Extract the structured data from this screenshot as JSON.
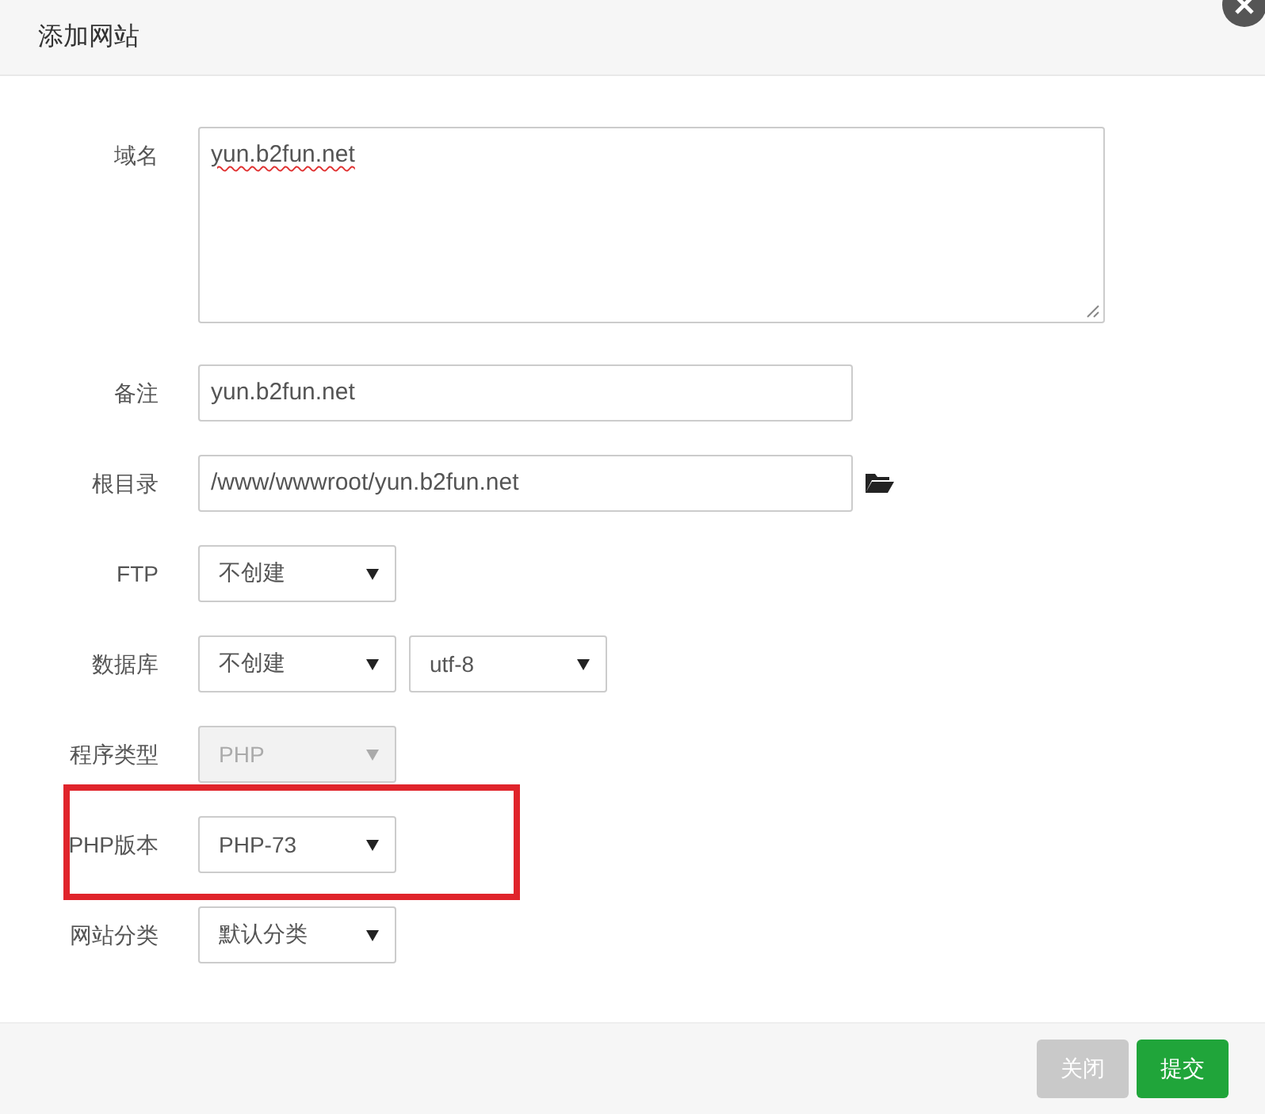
{
  "window": {
    "title": "添加网站"
  },
  "form": [
    {
      "label": "域名",
      "kind": "textarea",
      "value": "yun.b2fun.net",
      "spellcheck_error": true
    },
    {
      "label": "备注",
      "kind": "input",
      "value": "yun.b2fun.net"
    },
    {
      "label": "根目录",
      "kind": "path",
      "value": "/www/wwwroot/yun.b2fun.net"
    },
    {
      "label": "FTP",
      "kind": "select",
      "selects": [
        {
          "value": "不创建",
          "disabled": false
        }
      ]
    },
    {
      "label": "数据库",
      "kind": "select",
      "selects": [
        {
          "value": "不创建",
          "disabled": false
        },
        {
          "value": "utf-8",
          "disabled": false
        }
      ]
    },
    {
      "label": "程序类型",
      "kind": "select",
      "selects": [
        {
          "value": "PHP",
          "disabled": true
        }
      ]
    },
    {
      "label": "PHP版本",
      "kind": "select",
      "selects": [
        {
          "value": "PHP-73",
          "disabled": false
        }
      ],
      "highlighted": true
    },
    {
      "label": "网站分类",
      "kind": "select",
      "selects": [
        {
          "value": "默认分类",
          "disabled": false
        }
      ]
    }
  ],
  "buttons": [
    {
      "label": "关闭",
      "primary": false
    },
    {
      "label": "提交",
      "primary": true
    }
  ]
}
